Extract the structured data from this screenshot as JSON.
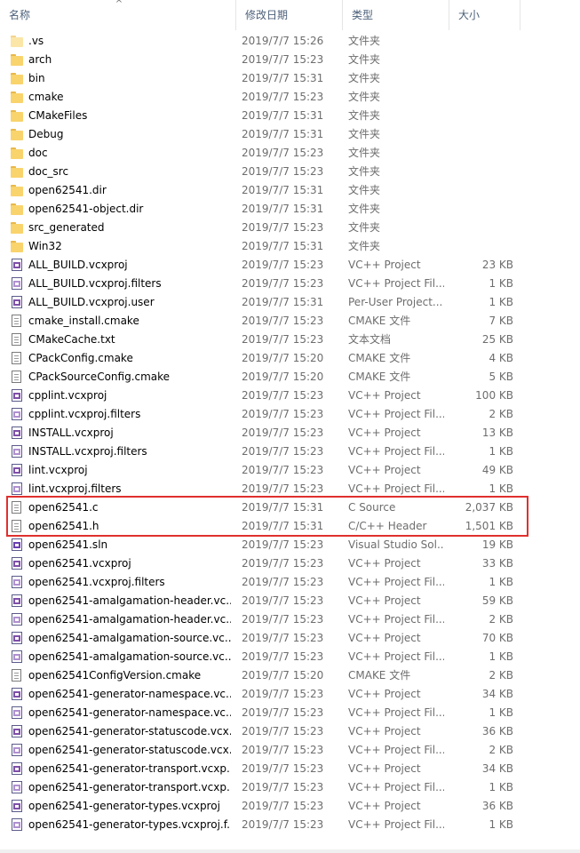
{
  "columns": {
    "name": "名称",
    "date": "修改日期",
    "type": "类型",
    "size": "大小"
  },
  "files": [
    {
      "name": ".vs",
      "date": "2019/7/7 15:26",
      "type": "文件夹",
      "size": "",
      "icon": "folder-light"
    },
    {
      "name": "arch",
      "date": "2019/7/7 15:23",
      "type": "文件夹",
      "size": "",
      "icon": "folder"
    },
    {
      "name": "bin",
      "date": "2019/7/7 15:31",
      "type": "文件夹",
      "size": "",
      "icon": "folder"
    },
    {
      "name": "cmake",
      "date": "2019/7/7 15:23",
      "type": "文件夹",
      "size": "",
      "icon": "folder"
    },
    {
      "name": "CMakeFiles",
      "date": "2019/7/7 15:31",
      "type": "文件夹",
      "size": "",
      "icon": "folder"
    },
    {
      "name": "Debug",
      "date": "2019/7/7 15:31",
      "type": "文件夹",
      "size": "",
      "icon": "folder"
    },
    {
      "name": "doc",
      "date": "2019/7/7 15:23",
      "type": "文件夹",
      "size": "",
      "icon": "folder"
    },
    {
      "name": "doc_src",
      "date": "2019/7/7 15:23",
      "type": "文件夹",
      "size": "",
      "icon": "folder"
    },
    {
      "name": "open62541.dir",
      "date": "2019/7/7 15:31",
      "type": "文件夹",
      "size": "",
      "icon": "folder"
    },
    {
      "name": "open62541-object.dir",
      "date": "2019/7/7 15:31",
      "type": "文件夹",
      "size": "",
      "icon": "folder"
    },
    {
      "name": "src_generated",
      "date": "2019/7/7 15:23",
      "type": "文件夹",
      "size": "",
      "icon": "folder"
    },
    {
      "name": "Win32",
      "date": "2019/7/7 15:31",
      "type": "文件夹",
      "size": "",
      "icon": "folder"
    },
    {
      "name": "ALL_BUILD.vcxproj",
      "date": "2019/7/7 15:23",
      "type": "VC++ Project",
      "size": "23 KB",
      "icon": "project"
    },
    {
      "name": "ALL_BUILD.vcxproj.filters",
      "date": "2019/7/7 15:23",
      "type": "VC++ Project Fil...",
      "size": "1 KB",
      "icon": "filters"
    },
    {
      "name": "ALL_BUILD.vcxproj.user",
      "date": "2019/7/7 15:31",
      "type": "Per-User Project...",
      "size": "1 KB",
      "icon": "user"
    },
    {
      "name": "cmake_install.cmake",
      "date": "2019/7/7 15:23",
      "type": "CMAKE 文件",
      "size": "7 KB",
      "icon": "doc"
    },
    {
      "name": "CMakeCache.txt",
      "date": "2019/7/7 15:23",
      "type": "文本文档",
      "size": "25 KB",
      "icon": "text"
    },
    {
      "name": "CPackConfig.cmake",
      "date": "2019/7/7 15:20",
      "type": "CMAKE 文件",
      "size": "4 KB",
      "icon": "doc"
    },
    {
      "name": "CPackSourceConfig.cmake",
      "date": "2019/7/7 15:20",
      "type": "CMAKE 文件",
      "size": "5 KB",
      "icon": "doc"
    },
    {
      "name": "cpplint.vcxproj",
      "date": "2019/7/7 15:23",
      "type": "VC++ Project",
      "size": "100 KB",
      "icon": "project"
    },
    {
      "name": "cpplint.vcxproj.filters",
      "date": "2019/7/7 15:23",
      "type": "VC++ Project Fil...",
      "size": "2 KB",
      "icon": "filters"
    },
    {
      "name": "INSTALL.vcxproj",
      "date": "2019/7/7 15:23",
      "type": "VC++ Project",
      "size": "13 KB",
      "icon": "project"
    },
    {
      "name": "INSTALL.vcxproj.filters",
      "date": "2019/7/7 15:23",
      "type": "VC++ Project Fil...",
      "size": "1 KB",
      "icon": "filters"
    },
    {
      "name": "lint.vcxproj",
      "date": "2019/7/7 15:23",
      "type": "VC++ Project",
      "size": "49 KB",
      "icon": "project"
    },
    {
      "name": "lint.vcxproj.filters",
      "date": "2019/7/7 15:23",
      "type": "VC++ Project Fil...",
      "size": "1 KB",
      "icon": "filters"
    },
    {
      "name": "open62541.c",
      "date": "2019/7/7 15:31",
      "type": "C Source",
      "size": "2,037 KB",
      "icon": "c-source"
    },
    {
      "name": "open62541.h",
      "date": "2019/7/7 15:31",
      "type": "C/C++ Header",
      "size": "1,501 KB",
      "icon": "c-header"
    },
    {
      "name": "open62541.sln",
      "date": "2019/7/7 15:23",
      "type": "Visual Studio Sol...",
      "size": "19 KB",
      "icon": "solution"
    },
    {
      "name": "open62541.vcxproj",
      "date": "2019/7/7 15:23",
      "type": "VC++ Project",
      "size": "33 KB",
      "icon": "project"
    },
    {
      "name": "open62541.vcxproj.filters",
      "date": "2019/7/7 15:23",
      "type": "VC++ Project Fil...",
      "size": "1 KB",
      "icon": "filters"
    },
    {
      "name": "open62541-amalgamation-header.vc...",
      "date": "2019/7/7 15:23",
      "type": "VC++ Project",
      "size": "59 KB",
      "icon": "project"
    },
    {
      "name": "open62541-amalgamation-header.vc...",
      "date": "2019/7/7 15:23",
      "type": "VC++ Project Fil...",
      "size": "2 KB",
      "icon": "filters"
    },
    {
      "name": "open62541-amalgamation-source.vc...",
      "date": "2019/7/7 15:23",
      "type": "VC++ Project",
      "size": "70 KB",
      "icon": "project"
    },
    {
      "name": "open62541-amalgamation-source.vc...",
      "date": "2019/7/7 15:23",
      "type": "VC++ Project Fil...",
      "size": "1 KB",
      "icon": "filters"
    },
    {
      "name": "open62541ConfigVersion.cmake",
      "date": "2019/7/7 15:20",
      "type": "CMAKE 文件",
      "size": "2 KB",
      "icon": "doc"
    },
    {
      "name": "open62541-generator-namespace.vc...",
      "date": "2019/7/7 15:23",
      "type": "VC++ Project",
      "size": "34 KB",
      "icon": "project"
    },
    {
      "name": "open62541-generator-namespace.vc...",
      "date": "2019/7/7 15:23",
      "type": "VC++ Project Fil...",
      "size": "1 KB",
      "icon": "filters"
    },
    {
      "name": "open62541-generator-statuscode.vcx...",
      "date": "2019/7/7 15:23",
      "type": "VC++ Project",
      "size": "36 KB",
      "icon": "project"
    },
    {
      "name": "open62541-generator-statuscode.vcx...",
      "date": "2019/7/7 15:23",
      "type": "VC++ Project Fil...",
      "size": "2 KB",
      "icon": "filters"
    },
    {
      "name": "open62541-generator-transport.vcxp...",
      "date": "2019/7/7 15:23",
      "type": "VC++ Project",
      "size": "34 KB",
      "icon": "project"
    },
    {
      "name": "open62541-generator-transport.vcxp...",
      "date": "2019/7/7 15:23",
      "type": "VC++ Project Fil...",
      "size": "1 KB",
      "icon": "filters"
    },
    {
      "name": "open62541-generator-types.vcxproj",
      "date": "2019/7/7 15:23",
      "type": "VC++ Project",
      "size": "36 KB",
      "icon": "project"
    },
    {
      "name": "open62541-generator-types.vcxproj.f...",
      "date": "2019/7/7 15:23",
      "type": "VC++ Project Fil...",
      "size": "1 KB",
      "icon": "filters"
    }
  ],
  "highlight_color": "#e0302e"
}
